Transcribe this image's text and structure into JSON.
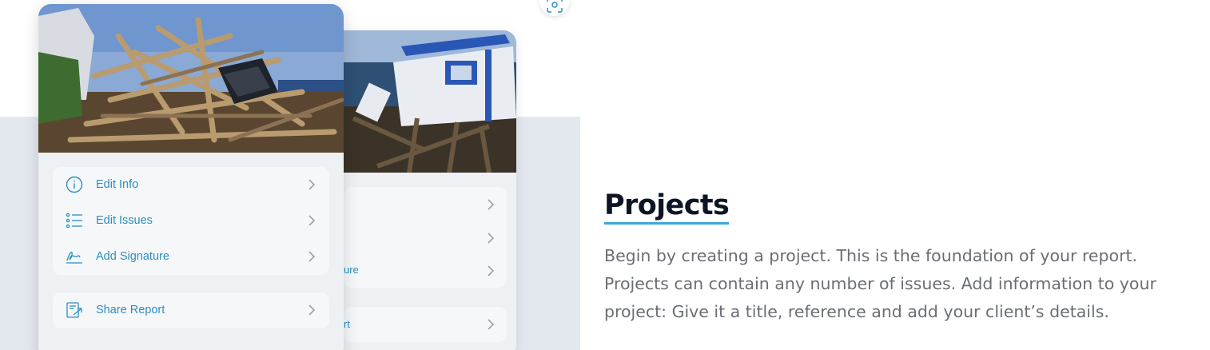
{
  "colors": {
    "accent": "#2c8fc0",
    "title_underline": "#3aa8d8",
    "band": "#e3e8ef",
    "title_text": "#0d1524",
    "body_text": "#6a6e74"
  },
  "front_card": {
    "photo_icon": "storm-debris-photo",
    "menu": [
      {
        "label": "Edit Info",
        "icon": "info-circle-icon"
      },
      {
        "label": "Edit Issues",
        "icon": "list-icon"
      },
      {
        "label": "Add Signature",
        "icon": "signature-icon"
      }
    ],
    "share": {
      "label": "Share Report",
      "icon": "share-report-icon"
    }
  },
  "back_card": {
    "photo_icon": "damaged-dock-photo",
    "partial_labels": [
      "ure",
      "rt"
    ]
  },
  "section": {
    "title": "Projects",
    "description": "Begin by creating a project. This is the foundation of your report. Projects can contain any number of issues. Add information to your project: Give it a title, reference and add your client’s details."
  }
}
